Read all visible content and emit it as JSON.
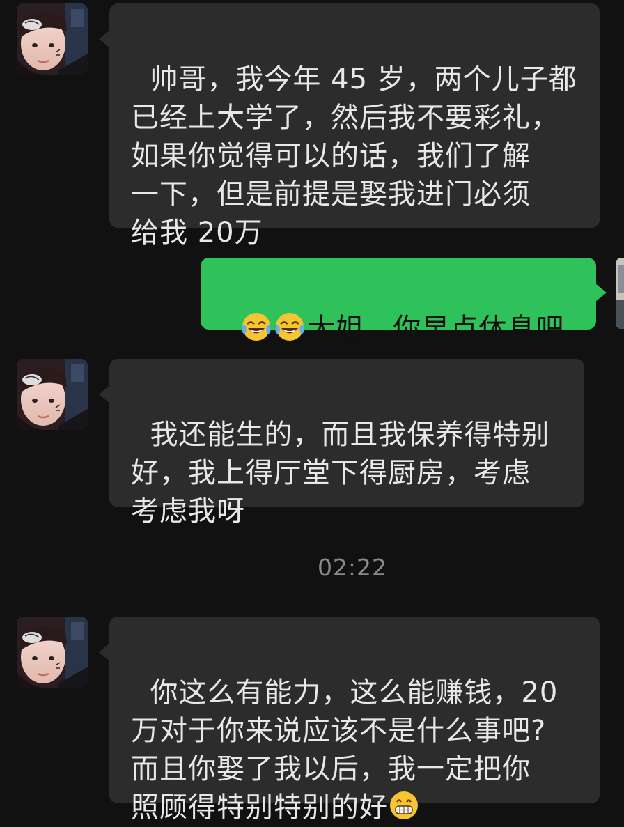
{
  "chat": {
    "messages": [
      {
        "sender": "other",
        "text": "帅哥，我今年 45 岁，两个儿子都\n已经上大学了，然后我不要彩礼，\n如果你觉得可以的话，我们了解\n一下，但是前提是娶我进门必须\n给我 20万"
      },
      {
        "sender": "self",
        "emoji": "face-with-tears-of-joy-icon",
        "text": "大姐，你早点休息吧"
      },
      {
        "sender": "other",
        "text": "我还能生的，而且我保养得特别\n好，我上得厅堂下得厨房，考虑\n考虑我呀"
      },
      {
        "sender": "system",
        "timestamp": "02:22"
      },
      {
        "sender": "other",
        "text": "你这么有能力，这么能赚钱，20\n万对于你来说应该不是什么事吧?\n而且你娶了我以后，我一定把你\n照顾得特别特别的好",
        "emoji": "grinning-face-icon"
      }
    ]
  },
  "colors": {
    "background": "#111111",
    "incoming_bubble": "#2c2c2c",
    "outgoing_bubble": "#2fc15a",
    "timestamp": "#8a8a8a"
  }
}
